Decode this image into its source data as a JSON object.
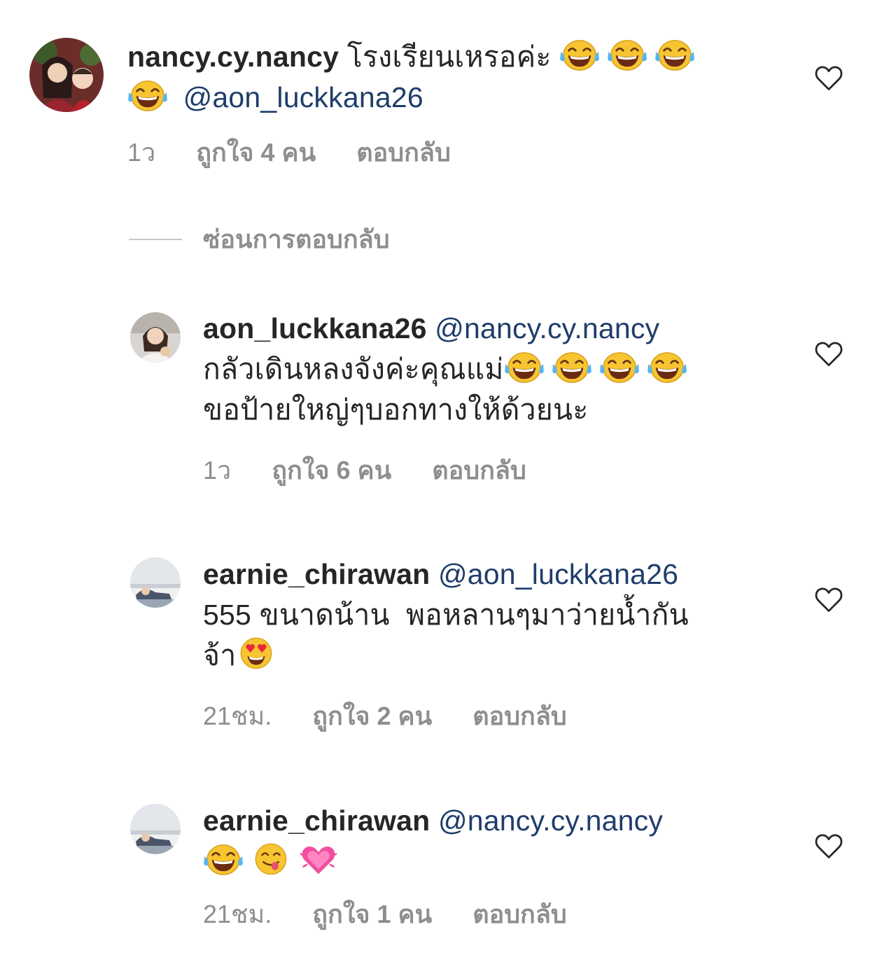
{
  "icons": {
    "heart": "heart-outline-icon",
    "emoji_laugh": "face-with-tears-of-joy-icon",
    "emoji_heart_eyes": "heart-eyes-face-icon",
    "emoji_yum": "face-savoring-food-icon",
    "emoji_growing_heart": "growing-heart-icon"
  },
  "colors": {
    "text": "#262626",
    "meta": "#8e8e8e",
    "mention": "#1f3d6b",
    "divider": "#c7c7c7"
  },
  "comments": [
    {
      "username": "nancy.cy.nancy",
      "text": "โรงเรียนเหรอค่ะ",
      "mention": "@aon_luckkana26",
      "time": "1ว",
      "likes": "ถูกใจ 4 คน",
      "reply": "ตอบกลับ"
    },
    {
      "username": "aon_luckkana26",
      "mention": "@nancy.cy.nancy",
      "text_line1": "กลัวเดินหลงจังค่ะคุณแม่",
      "text_line2": "ขอป้ายใหญ่ๆบอกทางให้ด้วยนะ",
      "time": "1ว",
      "likes": "ถูกใจ 6 คน",
      "reply": "ตอบกลับ"
    },
    {
      "username": "earnie_chirawan",
      "mention": "@aon_luckkana26",
      "text_line1": "555 ขนาดน้าน  พอหลานๆมาว่ายน้ำกัน",
      "text_line2": "จ้า",
      "time": "21ชม.",
      "likes": "ถูกใจ 2 คน",
      "reply": "ตอบกลับ"
    },
    {
      "username": "earnie_chirawan",
      "mention": "@nancy.cy.nancy",
      "time": "21ชม.",
      "likes": "ถูกใจ 1 คน",
      "reply": "ตอบกลับ"
    }
  ],
  "hide_replies_label": "ซ่อนการตอบกลับ"
}
